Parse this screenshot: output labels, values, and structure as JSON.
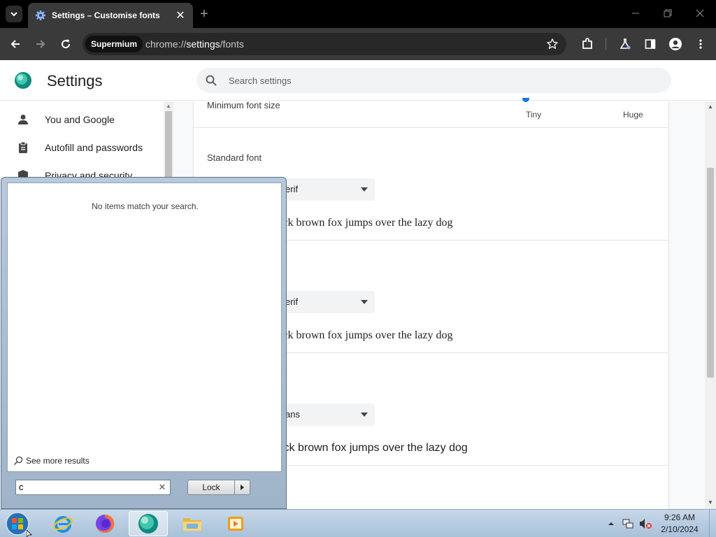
{
  "browser": {
    "tab_title": "Settings – Customise fonts",
    "tab_close": "✕",
    "new_tab": "+",
    "omnibox_chip": "Supermium",
    "url_scheme": "chrome://",
    "url_host": "settings",
    "url_path": "/fonts"
  },
  "settings": {
    "title": "Settings",
    "search_placeholder": "Search settings",
    "nav_items": [
      {
        "label": "You and Google",
        "icon": "person-icon"
      },
      {
        "label": "Autofill and passwords",
        "icon": "clipboard-icon"
      },
      {
        "label": "Privacy and security",
        "icon": "shield-icon"
      }
    ],
    "min_font_size_label": "Minimum font size",
    "tick_tiny": "Tiny",
    "tick_huge": "Huge",
    "standard_font_label": "Standard font",
    "fonts": [
      {
        "select_text": "erif",
        "sample": "ick brown fox jumps over the lazy dog"
      },
      {
        "select_text": "erif",
        "sample": "ick brown fox jumps over the lazy dog"
      },
      {
        "select_text": "ans",
        "sample": "ick brown fox jumps over the lazy dog"
      }
    ]
  },
  "start_menu": {
    "no_items_text": "No items match your search.",
    "see_more_text": "See more results",
    "search_value": "c",
    "clear_glyph": "✕",
    "lock_label": "Lock"
  },
  "taskbar": {
    "apps": [
      "internet-explorer-icon",
      "firefox-icon",
      "supermium-icon",
      "file-explorer-icon",
      "media-player-icon"
    ],
    "time": "9:26 AM",
    "date": "2/10/2024"
  },
  "colors": {
    "accent": "#1a73e8",
    "tab_bar": "#000000",
    "toolbar": "#3a3a3a"
  }
}
